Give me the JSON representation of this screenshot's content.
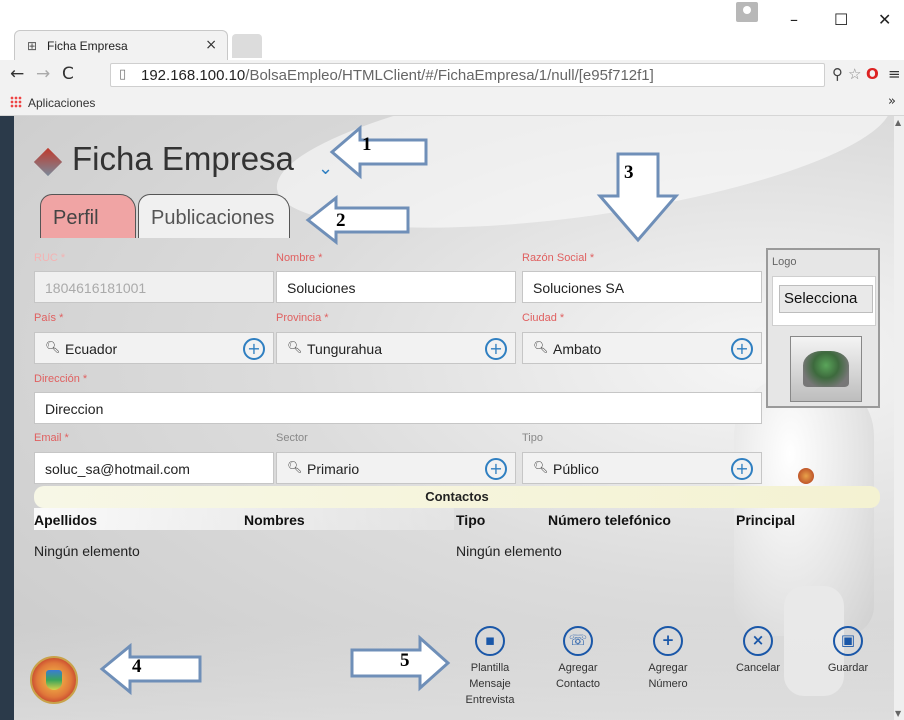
{
  "browser": {
    "tab_title": "Ficha Empresa",
    "tab_icon": "page-form-icon",
    "url_host": "192.168.100.10",
    "url_path": "/BolsaEmpleo/HTMLClient/#/FichaEmpresa/1/null/[e95f712f1]",
    "bookmarks_label": "Aplicaciones",
    "minimize": "–",
    "maximize": "☐",
    "close": "✕",
    "tab_close": "×"
  },
  "page": {
    "title": "Ficha Empresa",
    "tabs": [
      "Perfil",
      "Publicaciones"
    ]
  },
  "form": {
    "ruc": {
      "label": "RUC *",
      "value": "1804616181001"
    },
    "nombre": {
      "label": "Nombre *",
      "value": "Soluciones"
    },
    "razon_social": {
      "label": "Razón Social *",
      "value": "Soluciones SA"
    },
    "pais": {
      "label": "País *",
      "value": "Ecuador"
    },
    "provincia": {
      "label": "Provincia *",
      "value": "Tungurahua"
    },
    "ciudad": {
      "label": "Ciudad *",
      "value": "Ambato"
    },
    "direccion": {
      "label": "Dirección *",
      "value": "Direccion"
    },
    "email": {
      "label": "Email *",
      "value": "soluc_sa@hotmail.com"
    },
    "sector": {
      "label": "Sector",
      "value": "Primario"
    },
    "tipo": {
      "label": "Tipo",
      "value": "Público"
    }
  },
  "logo": {
    "label": "Logo",
    "button": "Selecciona"
  },
  "contactos": {
    "title": "Contactos",
    "columns": [
      "Apellidos",
      "Nombres",
      "Tipo",
      "Número telefónico",
      "Principal"
    ],
    "empty_left": "Ningún elemento",
    "empty_right": "Ningún elemento"
  },
  "actions": [
    {
      "icon": "chat-icon",
      "glyph": "▪",
      "lines": [
        "Plantilla",
        "Mensaje",
        "Entrevista"
      ]
    },
    {
      "icon": "phone-icon",
      "glyph": "☏",
      "lines": [
        "Agregar",
        "Contacto"
      ]
    },
    {
      "icon": "plus-icon",
      "glyph": "+",
      "lines": [
        "Agregar",
        "Número"
      ]
    },
    {
      "icon": "cancel-icon",
      "glyph": "×",
      "lines": [
        "Cancelar"
      ]
    },
    {
      "icon": "save-icon",
      "glyph": "▣",
      "lines": [
        "Guardar"
      ]
    }
  ],
  "annotations": [
    "1",
    "2",
    "3",
    "4",
    "5"
  ],
  "colors": {
    "accent_blue": "#2f7fc1",
    "required_label": "#e06060",
    "perfil_tab": "#f0a4a4",
    "arrow_fill": "#ffffff",
    "arrow_stroke": "#6f8fb8"
  }
}
